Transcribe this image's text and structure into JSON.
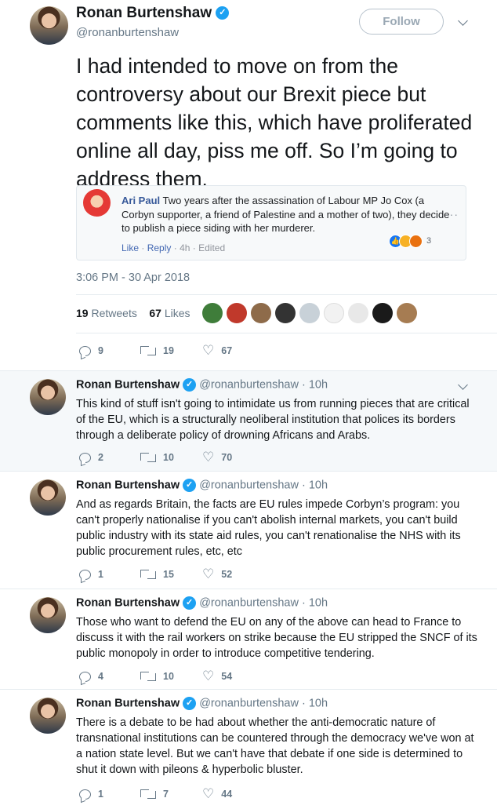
{
  "main_tweet": {
    "name": "Ronan Burtenshaw",
    "handle": "@ronanburtenshaw",
    "follow_label": "Follow",
    "text": "I had intended to move on from the controversy about our Brexit piece but comments like this, which have proliferated online all day, piss me off. So I’m going to address them.",
    "quoted": {
      "author": "Ari Paul",
      "text": "Two years after the assassination of Labour MP Jo Cox (a Corbyn supporter, a friend of Palestine and a mother of two), they decide to publish a piece siding with her murderer.",
      "like": "Like",
      "reply": "Reply",
      "sep": "·",
      "time": "4h",
      "edited": "Edited",
      "more": "···",
      "reaction_count": "3"
    },
    "timestamp": "3:06 PM - 30 Apr 2018",
    "retweets_count": "19",
    "retweets_label": "Retweets",
    "likes_count": "67",
    "likes_label": "Likes",
    "actions": {
      "replies": "9",
      "retweets": "19",
      "likes": "67"
    }
  },
  "replies": [
    {
      "name": "Ronan Burtenshaw",
      "handle": "@ronanburtenshaw",
      "time": "· 10h",
      "text": "This kind of stuff isn't going to intimidate us from running pieces that are critical of the EU, which is a structurally neoliberal institution that polices its borders through a deliberate policy of drowning Africans and Arabs.",
      "replies": "2",
      "retweets": "10",
      "likes": "70"
    },
    {
      "name": "Ronan Burtenshaw",
      "handle": "@ronanburtenshaw",
      "time": "· 10h",
      "text": "And as regards Britain, the facts are EU rules impede Corbyn’s program: you can't properly nationalise if you can't abolish internal markets, you can't build public industry with its state aid rules, you can't renationalise the NHS with its public procurement rules, etc, etc",
      "replies": "1",
      "retweets": "15",
      "likes": "52"
    },
    {
      "name": "Ronan Burtenshaw",
      "handle": "@ronanburtenshaw",
      "time": "· 10h",
      "text": "Those who want to defend the EU on any of the above can head to France to discuss it with the rail workers on strike because the EU stripped the SNCF of its public monopoly in order to introduce competitive tendering.",
      "replies": "4",
      "retweets": "10",
      "likes": "54"
    },
    {
      "name": "Ronan Burtenshaw",
      "handle": "@ronanburtenshaw",
      "time": "· 10h",
      "text": "There is a debate to be had about whether the anti-democratic nature of transnational institutions can be countered through the democracy we've won at a nation state level. But we can't have that debate if one side is determined to shut it down with pileons & hyperbolic bluster.",
      "replies": "1",
      "retweets": "7",
      "likes": "44"
    }
  ],
  "colors": {
    "accent": "#1da1f2",
    "secondary_text": "#657786",
    "reply_bg": "#f5f8fa"
  }
}
